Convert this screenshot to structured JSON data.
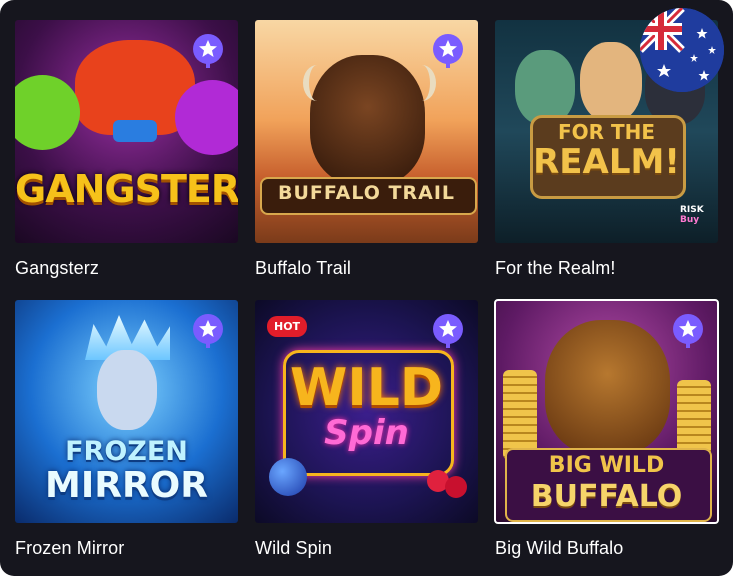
{
  "games": [
    {
      "title": "Gangsterz",
      "art_text": "GANGSTERZ",
      "colors": [
        "#f6c21a",
        "#7a2a6b"
      ]
    },
    {
      "title": "Buffalo Trail",
      "art_text": "BUFFALO TRAIL",
      "colors": [
        "#e47e3c",
        "#6b3517"
      ]
    },
    {
      "title": "For the Realm!",
      "art_text_line1": "FOR THE",
      "art_text_line2": "REALM!",
      "badge_line1": "RISK",
      "badge_line2": "Buy",
      "colors": [
        "#1d3a4a",
        "#f2c24a"
      ]
    },
    {
      "title": "Frozen Mirror",
      "art_text_line1": "FROZEN",
      "art_text_line2": "MIRROR",
      "colors": [
        "#1b6fd1",
        "#a7e7ff"
      ]
    },
    {
      "title": "Wild Spin",
      "art_text_line1": "WILD",
      "art_text_line2": "Spin",
      "badge": "HOT",
      "colors": [
        "#1c1452",
        "#f7b51d"
      ]
    },
    {
      "title": "Big Wild Buffalo",
      "art_text_line1": "BIG WILD",
      "art_text_line2": "BUFFALO",
      "colors": [
        "#5e1a64",
        "#f0c44a"
      ]
    }
  ],
  "favorite_icon": "star-badge-icon",
  "region_flag": "australia-flag-icon",
  "accent_favorite": "#7a5cff"
}
